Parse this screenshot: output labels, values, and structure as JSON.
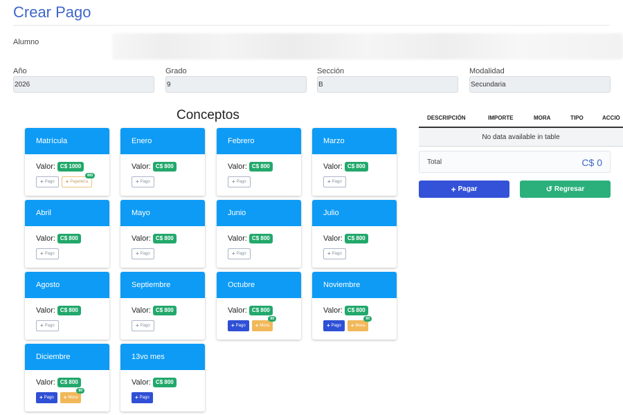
{
  "page": {
    "title": "Crear Pago"
  },
  "form": {
    "alumno_label": "Alumno",
    "anio_label": "Año",
    "anio_value": "2026",
    "grado_label": "Grado",
    "grado_value": "9",
    "seccion_label": "Sección",
    "seccion_value": "B",
    "modalidad_label": "Modalidad",
    "modalidad_value": "Secundaria"
  },
  "conceptos": {
    "title": "Conceptos",
    "valor_label": "Valor:",
    "pago_label": "Pago",
    "mora_label": "Mora",
    "papeleria_label": "Papelería",
    "papeleria_badge": "400",
    "mora_badge": "60",
    "cards": [
      {
        "name": "Matrícula",
        "amount": "C$ 1000"
      },
      {
        "name": "Enero",
        "amount": "C$ 800"
      },
      {
        "name": "Febrero",
        "amount": "C$ 800"
      },
      {
        "name": "Marzo",
        "amount": "C$ 800"
      },
      {
        "name": "Abril",
        "amount": "C$ 800"
      },
      {
        "name": "Mayo",
        "amount": "C$ 800"
      },
      {
        "name": "Junio",
        "amount": "C$ 800"
      },
      {
        "name": "Julio",
        "amount": "C$ 800"
      },
      {
        "name": "Agosto",
        "amount": "C$ 800"
      },
      {
        "name": "Septiembre",
        "amount": "C$ 800"
      },
      {
        "name": "Octubre",
        "amount": "C$ 800"
      },
      {
        "name": "Noviembre",
        "amount": "C$ 800"
      },
      {
        "name": "Diciembre",
        "amount": "C$ 800"
      },
      {
        "name": "13vo mes",
        "amount": "C$ 800"
      }
    ]
  },
  "table": {
    "columns": [
      "DESCRIPCIÓN",
      "IMPORTE",
      "MORA",
      "TIPO",
      "ACCIÓ"
    ],
    "empty_text": "No data available in table",
    "total_label": "Total",
    "total_value": "C$ 0"
  },
  "actions": {
    "pagar_label": "Pagar",
    "regresar_label": "Regresar"
  },
  "colors": {
    "card_header": "#0d9bf5",
    "amount_badge": "#22a86b",
    "pagar": "#3352d8",
    "regresar": "#2bb07c",
    "mora": "#f1b85a"
  }
}
